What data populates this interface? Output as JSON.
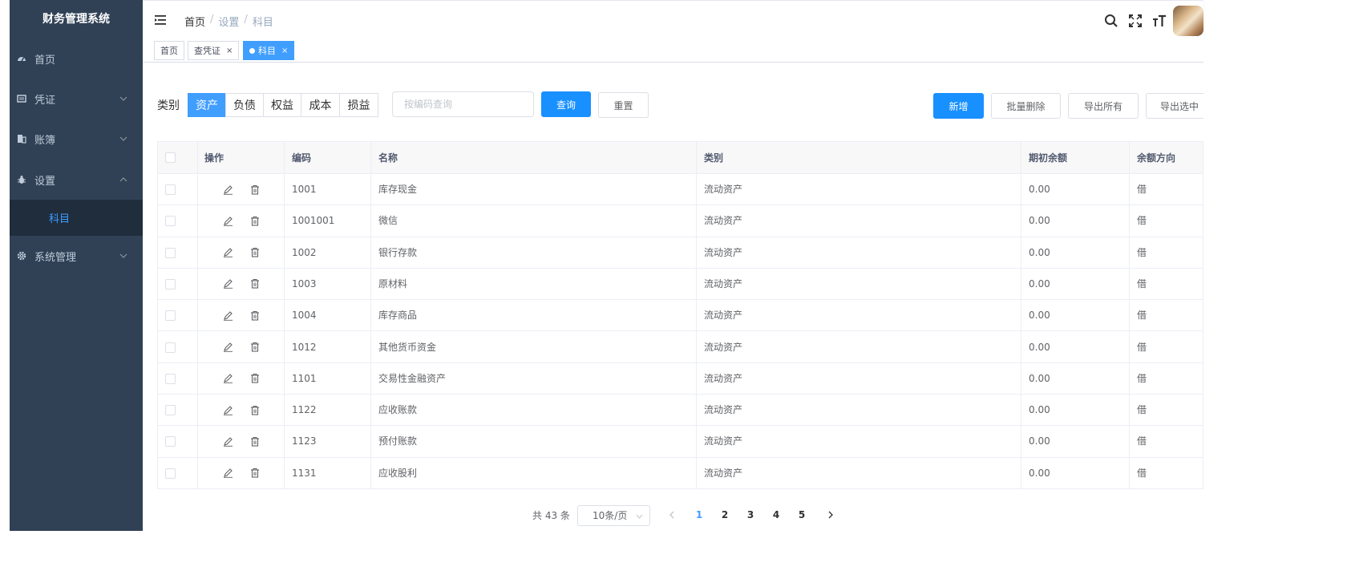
{
  "sidebar": {
    "title": "财务管理系统",
    "items": [
      {
        "label": "首页",
        "icon": "dashboard-icon"
      },
      {
        "label": "凭证",
        "icon": "voucher-icon"
      },
      {
        "label": "账簿",
        "icon": "ledger-icon"
      },
      {
        "label": "设置",
        "icon": "bug-icon"
      },
      {
        "label": "系统管理",
        "icon": "gear-icon"
      }
    ],
    "active_sub": "科目"
  },
  "navbar": {
    "breadcrumb": [
      "首页",
      "设置",
      "科目"
    ]
  },
  "tags": [
    {
      "label": "首页"
    },
    {
      "label": "查凭证",
      "close": "×"
    },
    {
      "label": "科目",
      "close": "×"
    }
  ],
  "filters": {
    "label": "类别",
    "categories": [
      "资产",
      "负债",
      "权益",
      "成本",
      "损益"
    ],
    "active_category": "资产",
    "search_placeholder": "按编码查询",
    "query": "查询",
    "reset": "重置"
  },
  "actions": {
    "add": "新增",
    "batch_delete": "批量删除",
    "export_all": "导出所有",
    "export_selected": "导出选中"
  },
  "table": {
    "headers": [
      "操作",
      "编码",
      "名称",
      "类别",
      "期初余额",
      "余额方向"
    ],
    "rows": [
      {
        "code": "1001",
        "name": "库存现金",
        "category": "流动资产",
        "balance": "0.00",
        "direction": "借"
      },
      {
        "code": "1001001",
        "name": "微信",
        "category": "流动资产",
        "balance": "0.00",
        "direction": "借"
      },
      {
        "code": "1002",
        "name": "银行存款",
        "category": "流动资产",
        "balance": "0.00",
        "direction": "借"
      },
      {
        "code": "1003",
        "name": "原材料",
        "category": "流动资产",
        "balance": "0.00",
        "direction": "借"
      },
      {
        "code": "1004",
        "name": "库存商品",
        "category": "流动资产",
        "balance": "0.00",
        "direction": "借"
      },
      {
        "code": "1012",
        "name": "其他货币资金",
        "category": "流动资产",
        "balance": "0.00",
        "direction": "借"
      },
      {
        "code": "1101",
        "name": "交易性金融资产",
        "category": "流动资产",
        "balance": "0.00",
        "direction": "借"
      },
      {
        "code": "1122",
        "name": "应收账款",
        "category": "流动资产",
        "balance": "0.00",
        "direction": "借"
      },
      {
        "code": "1123",
        "name": "预付账款",
        "category": "流动资产",
        "balance": "0.00",
        "direction": "借"
      },
      {
        "code": "1131",
        "name": "应收股利",
        "category": "流动资产",
        "balance": "0.00",
        "direction": "借"
      }
    ]
  },
  "pagination": {
    "total": "共 43 条",
    "page_size": "10条/页",
    "pages": [
      "1",
      "2",
      "3",
      "4",
      "5"
    ],
    "current": "1"
  },
  "colors": {
    "sidebar_bg": "#304156",
    "submenu_bg": "#1f2d3d",
    "primary": "#1890ff",
    "link": "#409eff"
  }
}
